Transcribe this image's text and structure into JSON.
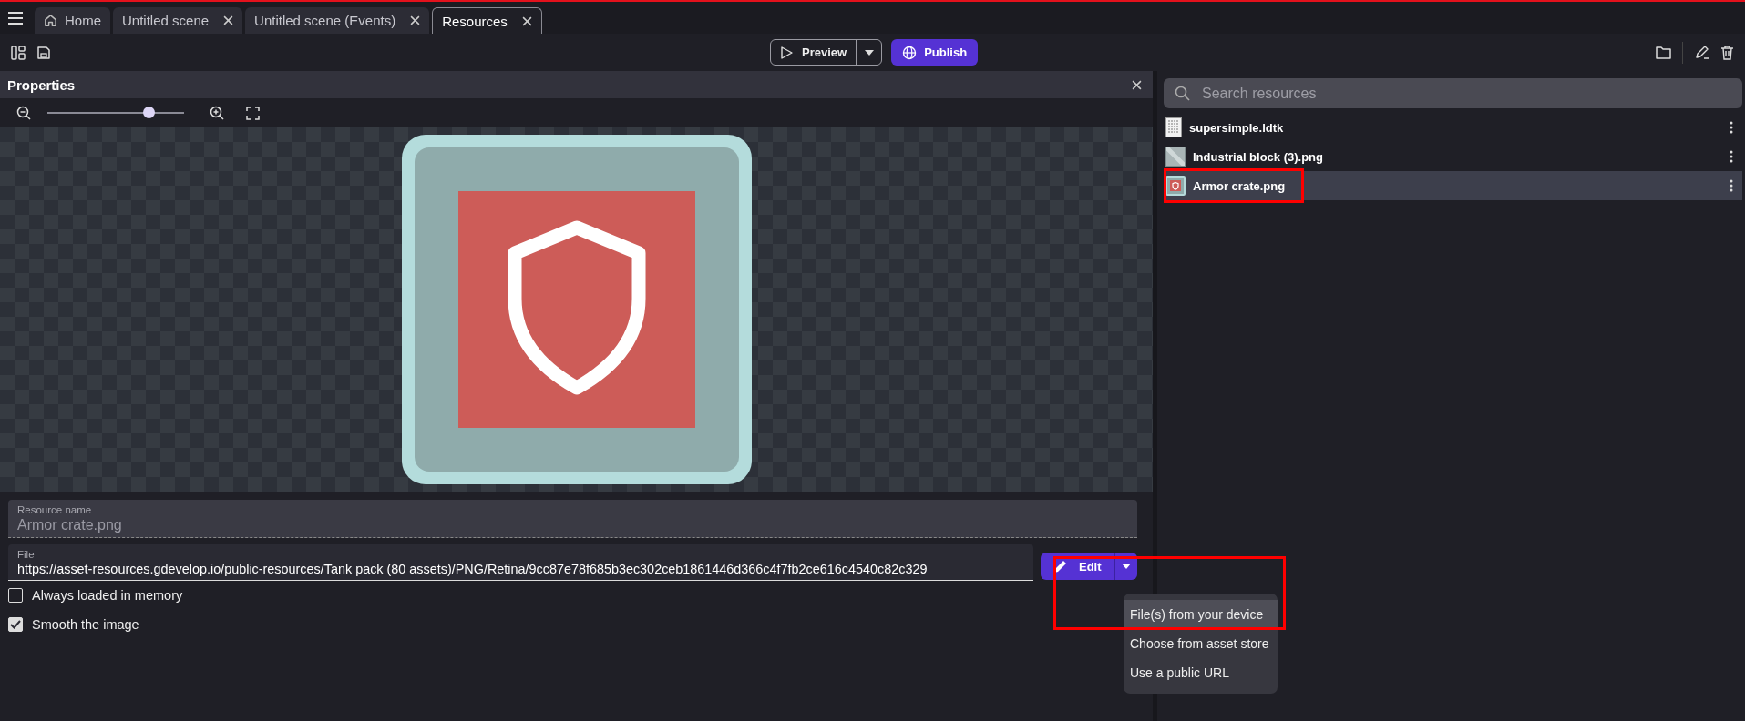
{
  "tabs": [
    {
      "label": "Home",
      "kind": "home",
      "selected": false,
      "closable": false
    },
    {
      "label": "Untitled scene",
      "kind": "scene",
      "selected": false,
      "closable": true
    },
    {
      "label": "Untitled scene (Events)",
      "kind": "scene",
      "selected": false,
      "closable": true
    },
    {
      "label": "Resources",
      "kind": "scene",
      "selected": true,
      "closable": true
    }
  ],
  "toolbar": {
    "preview": "Preview",
    "publish": "Publish"
  },
  "properties": {
    "title": "Properties",
    "zoom": {
      "level": 0.74
    },
    "resource_name": {
      "label": "Resource name",
      "value": "Armor crate.png"
    },
    "file": {
      "label": "File",
      "value": "https://asset-resources.gdevelop.io/public-resources/Tank pack (80 assets)/PNG/Retina/9cc87e78f685b3ec302ceb1861446d366c4f7fb2ce616c4540c82c329"
    },
    "edit_button": {
      "label": "Edit"
    },
    "options": [
      {
        "label": "Always loaded in memory",
        "checked": false
      },
      {
        "label": "Smooth the image",
        "checked": true
      }
    ]
  },
  "edit_menu": {
    "highlighted": true,
    "items": [
      {
        "label": "File(s) from your device",
        "selected": true
      },
      {
        "label": "Choose from asset store",
        "selected": false
      },
      {
        "label": "Use a public URL",
        "selected": false
      }
    ]
  },
  "resources": {
    "search": {
      "placeholder": "Search resources"
    },
    "items": [
      {
        "name": "supersimple.ldtk",
        "kind": "document",
        "selected": false,
        "highlighted": false
      },
      {
        "name": "Industrial block (3).png",
        "kind": "block",
        "selected": false,
        "highlighted": false
      },
      {
        "name": "Armor crate.png",
        "kind": "crate",
        "selected": true,
        "highlighted": true
      }
    ]
  }
}
